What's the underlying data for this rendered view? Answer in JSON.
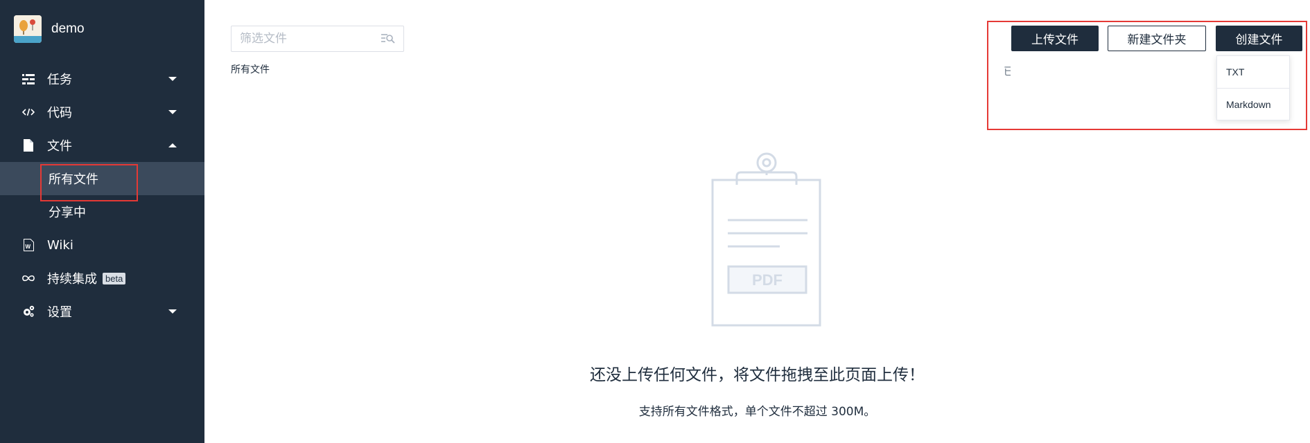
{
  "brand": {
    "name": "demo"
  },
  "sidebar": {
    "items": [
      {
        "label": "任务",
        "icon": "tasks-icon",
        "expanded": false
      },
      {
        "label": "代码",
        "icon": "code-icon",
        "expanded": false
      },
      {
        "label": "文件",
        "icon": "file-icon",
        "expanded": true,
        "children": [
          {
            "label": "所有文件",
            "active": true
          },
          {
            "label": "分享中"
          }
        ]
      },
      {
        "label": "Wiki",
        "icon": "wiki-icon"
      },
      {
        "label": "持续集成",
        "icon": "infinity-icon",
        "badge": "beta"
      },
      {
        "label": "设置",
        "icon": "settings-icon",
        "expanded": false
      }
    ]
  },
  "search": {
    "placeholder": "筛选文件"
  },
  "breadcrumb": "所有文件",
  "toolbar": {
    "upload_label": "上传文件",
    "new_folder_label": "新建文件夹",
    "create_file_label": "创建文件",
    "partial_text": "已"
  },
  "create_menu": {
    "options": [
      "TXT",
      "Markdown"
    ]
  },
  "empty": {
    "pdf_label": "PDF",
    "title": "还没上传任何文件，将文件拖拽至此页面上传！",
    "subtitle": "支持所有文件格式，单个文件不超过 300M。"
  },
  "colors": {
    "sidebar_bg": "#1f2d3d",
    "active_item_bg": "#3b4a5c",
    "primary": "#1f2d3d",
    "highlight_box": "#e53935",
    "illustration": "#d3dbe6"
  }
}
